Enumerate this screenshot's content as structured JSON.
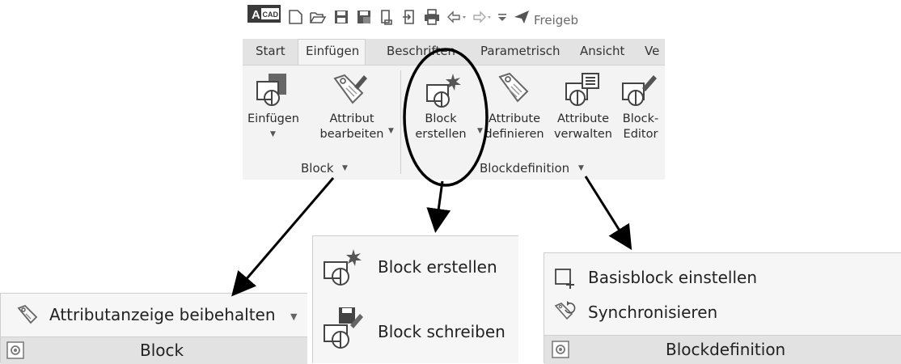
{
  "app": {
    "logo_letter": "A",
    "logo_text": "CAD",
    "qat_trailing_text": "Freigeb"
  },
  "tabs": [
    {
      "label": "Start"
    },
    {
      "label": "Einfügen",
      "active": true
    },
    {
      "label": "Beschriften"
    },
    {
      "label": "Parametrisch"
    },
    {
      "label": "Ansicht"
    },
    {
      "label": "Ve"
    }
  ],
  "panels": {
    "block": {
      "title": "Block",
      "buttons": [
        {
          "line1": "Einfügen",
          "line2": ""
        },
        {
          "line1": "Attribut",
          "line2": "bearbeiten"
        }
      ]
    },
    "blockdefinition": {
      "title": "Blockdefinition",
      "buttons": [
        {
          "line1": "Block",
          "line2": "erstellen"
        },
        {
          "line1": "Attribute",
          "line2": "definieren"
        },
        {
          "line1": "Attribute",
          "line2": "verwalten"
        },
        {
          "line1": "Block-",
          "line2": "Editor"
        }
      ]
    }
  },
  "popups": {
    "block_expanded": {
      "item": "Attributanzeige beibehalten",
      "footer": "Block"
    },
    "block_create": {
      "items": [
        "Block erstellen",
        "Block schreiben"
      ]
    },
    "blockdefinition_expanded": {
      "items": [
        "Basisblock einstellen",
        "Synchronisieren"
      ],
      "footer": "Blockdefinition"
    }
  },
  "colors": {
    "ribbon_bg": "#f3f3f3",
    "tab_strip": "#e3e3e3",
    "footer_bg": "#e2e2e2",
    "annotation": "#000000"
  }
}
